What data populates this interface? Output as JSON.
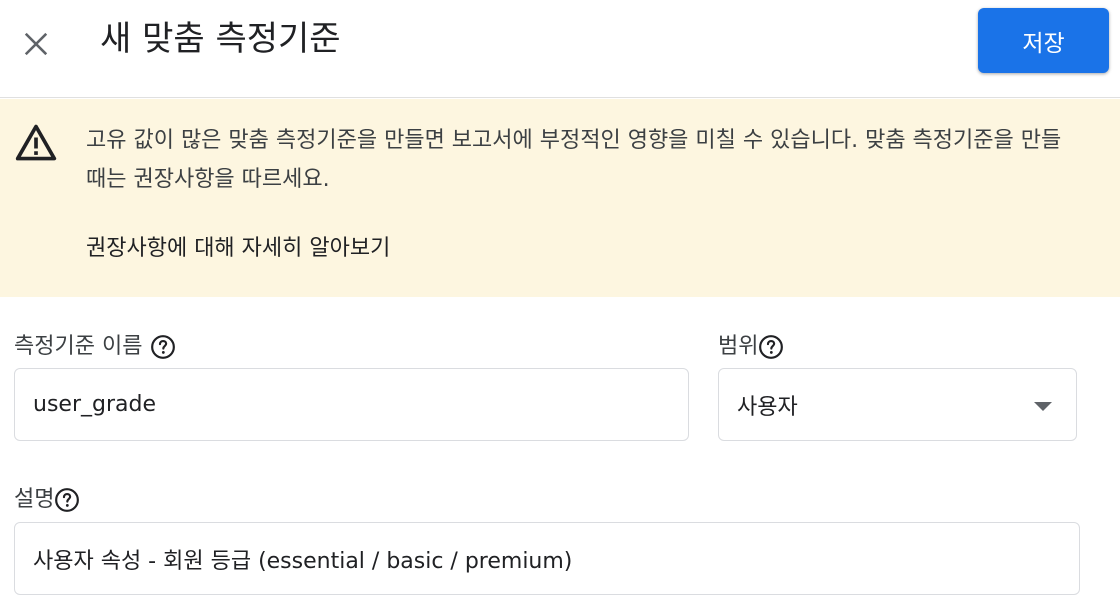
{
  "header": {
    "close_icon": "close-icon",
    "title": "새 맞춤 측정기준",
    "save_label": "저장",
    "save_color": "#1a73e8"
  },
  "banner": {
    "icon": "warning-icon",
    "background": "#fdf6e0",
    "message": "고유 값이 많은 맞춤 측정기준을 만들면 보고서에 부정적인 영향을 미칠 수 있습니다. 맞춤 측정기준을 만들 때는 권장사항을 따르세요.",
    "link_text": "권장사항에 대해 자세히 알아보기"
  },
  "form": {
    "dimension_name": {
      "label": "측정기준 이름",
      "value": "user_grade",
      "help_icon": "help-icon"
    },
    "scope": {
      "label": "범위",
      "value": "사용자",
      "help_icon": "help-icon"
    },
    "description": {
      "label": "설명",
      "value": "사용자 속성 - 회원 등급 (essential / basic / premium)",
      "help_icon": "help-icon"
    }
  }
}
